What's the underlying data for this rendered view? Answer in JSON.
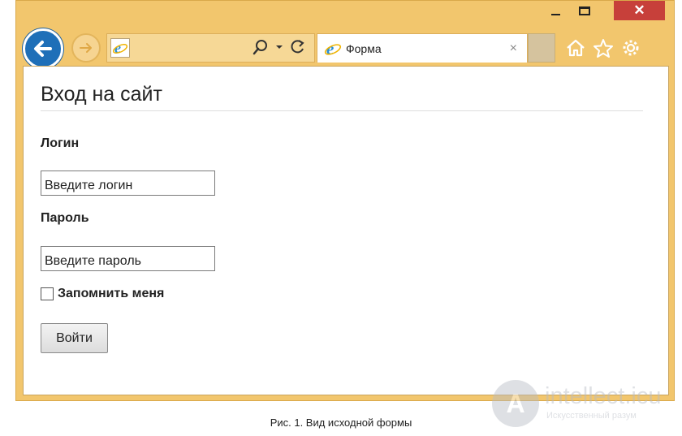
{
  "browser": {
    "titlebar": {
      "close_glyph": "✕"
    },
    "tab": {
      "title": "Форма",
      "close_glyph": "×"
    },
    "icons": {
      "back": "back-arrow-icon",
      "forward": "forward-arrow-icon",
      "site": "ie-icon",
      "search": "search-icon",
      "dropdown": "chevron-down-icon",
      "refresh": "refresh-icon",
      "home": "home-icon",
      "favorites": "star-icon",
      "settings": "gear-icon"
    },
    "colors": {
      "frame": "#f2c66d",
      "close": "#c7403a",
      "back": "#1e6fb8"
    }
  },
  "page": {
    "title": "Вход на сайт",
    "login_label": "Логин",
    "login_placeholder": "Введите логин",
    "password_label": "Пароль",
    "password_placeholder": "Введите пароль",
    "remember_label": "Запомнить меня",
    "remember_checked": false,
    "submit_label": "Войти"
  },
  "caption": "Рис. 1. Вид исходной формы",
  "watermark": {
    "letter": "A",
    "text": "intellect.icu",
    "subtitle": "Искусственный разум"
  }
}
